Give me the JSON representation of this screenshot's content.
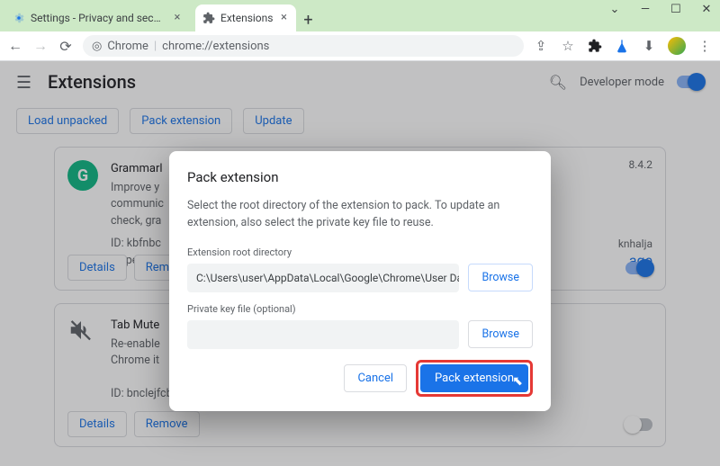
{
  "window": {
    "tabs": [
      {
        "title": "Settings - Privacy and security"
      },
      {
        "title": "Extensions"
      }
    ]
  },
  "addressbar": {
    "scheme_label": "Chrome",
    "url": "chrome://extensions"
  },
  "page": {
    "title": "Extensions",
    "developer_mode_label": "Developer mode",
    "buttons": {
      "load_unpacked": "Load unpacked",
      "pack_extension": "Pack extension",
      "update": "Update"
    }
  },
  "extensions": [
    {
      "name": "Grammarl",
      "version": "8.4.2",
      "desc_line1": "Improve y",
      "desc_line2": "communic",
      "desc_line3": "check, gra",
      "id_line": "ID: kbfnbc",
      "inspect_line": "Inspect vi",
      "link_text": "age",
      "details": "Details",
      "remove": "Remove",
      "enabled": true
    },
    {
      "name": "Tab Mute",
      "desc_line1": "Re-enable",
      "desc_line2": "Chrome it",
      "id_line": "ID: bnclejfcblondkjliiblkojdeloomadd",
      "details": "Details",
      "remove": "Remove",
      "enabled": false
    }
  ],
  "dialog": {
    "title": "Pack extension",
    "description": "Select the root directory of the extension to pack. To update an extension, also select the private key file to reuse.",
    "root_label": "Extension root directory",
    "root_value": "C:\\Users\\user\\AppData\\Local\\Google\\Chrome\\User Data\\Pro…",
    "key_label": "Private key file (optional)",
    "key_value": "",
    "browse": "Browse",
    "cancel": "Cancel",
    "submit": "Pack extension"
  }
}
